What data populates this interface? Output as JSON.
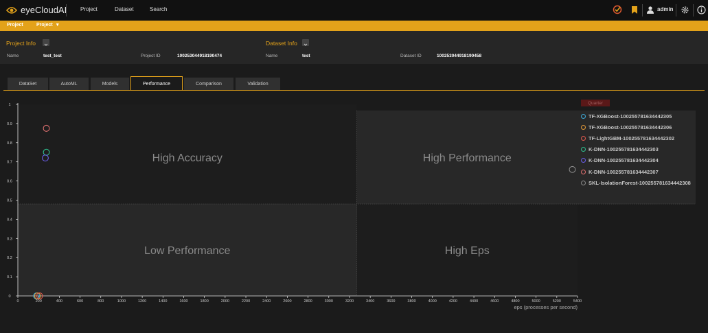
{
  "app": {
    "name": "eyeCloudAI"
  },
  "nav": {
    "items": [
      "Project",
      "Dataset",
      "Search"
    ]
  },
  "user": {
    "name": "admin"
  },
  "breadcrumb": {
    "root": "Project",
    "current": "Project"
  },
  "project_info": {
    "title": "Project Info",
    "name_label": "Name",
    "name_value": "test_test",
    "id_label": "Project ID",
    "id_value": "100253044918190474"
  },
  "dataset_info": {
    "title": "Dataset Info",
    "name_label": "Name",
    "name_value": "test",
    "id_label": "Dataset ID",
    "id_value": "100253044918190458"
  },
  "tabs": [
    "DataSet",
    "AutoML",
    "Models",
    "Performance",
    "Comparison",
    "Validation"
  ],
  "active_tab": "Performance",
  "legend": {
    "button": "Quarter"
  },
  "colors": {
    "accent": "#e3a21a",
    "nav_bg": "#111111",
    "page_bg": "#1b1b1b"
  },
  "chart_data": {
    "type": "scatter",
    "xlabel": "eps (processes per second)",
    "ylabel": "",
    "xlim": [
      0,
      5400
    ],
    "ylim": [
      0,
      1
    ],
    "x_ticks": [
      0,
      200,
      400,
      600,
      800,
      1000,
      1200,
      1400,
      1600,
      1800,
      2000,
      2200,
      2400,
      2600,
      2800,
      3000,
      3200,
      3400,
      3600,
      3800,
      4000,
      4200,
      4400,
      4600,
      4800,
      5000,
      5200,
      5400
    ],
    "y_ticks": [
      0,
      0.1,
      0.2,
      0.3,
      0.4,
      0.5,
      0.6,
      0.7,
      0.8,
      0.9,
      1
    ],
    "quadrant_split": {
      "x": 3270,
      "y": 0.48
    },
    "quadrants": {
      "top_left": "High Accuracy",
      "top_right": "High Performance",
      "bottom_left": "Low Performance",
      "bottom_right": "High Eps"
    },
    "series": [
      {
        "name": "TF-XGBoost-100255781634442305",
        "color": "#3fa9d6",
        "points": [
          [
            180,
            0.0
          ]
        ]
      },
      {
        "name": "TF-XGBoost-100255781634442306",
        "color": "#e39a3a",
        "points": [
          [
            190,
            0.0
          ]
        ]
      },
      {
        "name": "TF-LightGBM-100255781634442302",
        "color": "#e05a4e",
        "points": [
          [
            210,
            0.0
          ]
        ]
      },
      {
        "name": "K-DNN-100255781634442303",
        "color": "#2fbf8f",
        "points": [
          [
            275,
            0.75
          ]
        ]
      },
      {
        "name": "K-DNN-100255781634442304",
        "color": "#6a5ee8",
        "points": [
          [
            265,
            0.72
          ]
        ]
      },
      {
        "name": "K-DNN-100255781634442307",
        "color": "#e07070",
        "points": [
          [
            275,
            0.875
          ]
        ]
      },
      {
        "name": "SKL-IsolationForest-100255781634442308",
        "color": "#8a8a8a",
        "points": [
          [
            5350,
            0.66
          ]
        ]
      }
    ]
  }
}
